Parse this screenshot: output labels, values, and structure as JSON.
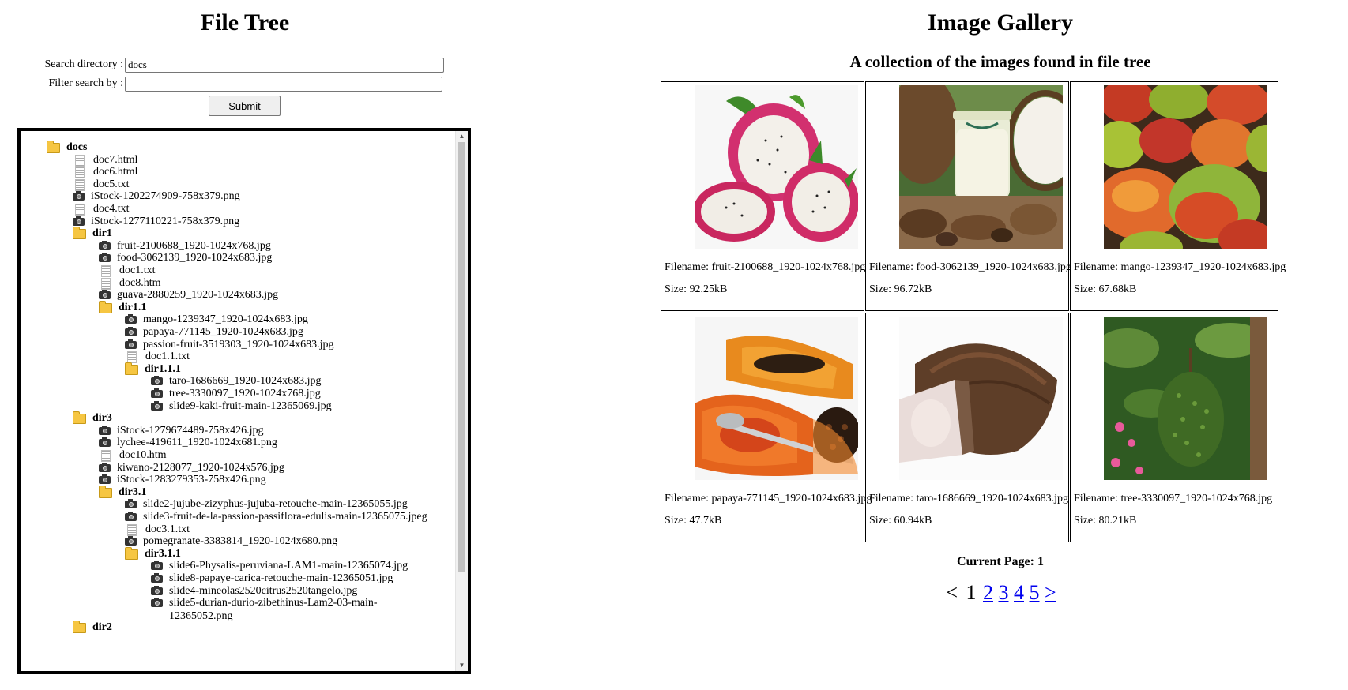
{
  "file_tree": {
    "title": "File Tree",
    "search_label": "Search directory :",
    "search_value": "docs",
    "filter_label": "Filter search by :",
    "filter_value": "",
    "submit_label": "Submit",
    "items": [
      {
        "name": "docs",
        "type": "folder",
        "depth": 0
      },
      {
        "name": "doc7.html",
        "type": "doc",
        "depth": 1
      },
      {
        "name": "doc6.html",
        "type": "doc",
        "depth": 1
      },
      {
        "name": "doc5.txt",
        "type": "doc",
        "depth": 1
      },
      {
        "name": "iStock-1202274909-758x379.png",
        "type": "image",
        "depth": 1
      },
      {
        "name": "doc4.txt",
        "type": "doc",
        "depth": 1
      },
      {
        "name": "iStock-1277110221-758x379.png",
        "type": "image",
        "depth": 1
      },
      {
        "name": "dir1",
        "type": "folder",
        "depth": 1
      },
      {
        "name": "fruit-2100688_1920-1024x768.jpg",
        "type": "image",
        "depth": 2
      },
      {
        "name": "food-3062139_1920-1024x683.jpg",
        "type": "image",
        "depth": 2
      },
      {
        "name": "doc1.txt",
        "type": "doc",
        "depth": 2
      },
      {
        "name": "doc8.htm",
        "type": "doc",
        "depth": 2
      },
      {
        "name": "guava-2880259_1920-1024x683.jpg",
        "type": "image",
        "depth": 2
      },
      {
        "name": "dir1.1",
        "type": "folder",
        "depth": 2
      },
      {
        "name": "mango-1239347_1920-1024x683.jpg",
        "type": "image",
        "depth": 3
      },
      {
        "name": "papaya-771145_1920-1024x683.jpg",
        "type": "image",
        "depth": 3
      },
      {
        "name": "passion-fruit-3519303_1920-1024x683.jpg",
        "type": "image",
        "depth": 3
      },
      {
        "name": "doc1.1.txt",
        "type": "doc",
        "depth": 3
      },
      {
        "name": "dir1.1.1",
        "type": "folder",
        "depth": 3
      },
      {
        "name": "taro-1686669_1920-1024x683.jpg",
        "type": "image",
        "depth": 4
      },
      {
        "name": "tree-3330097_1920-1024x768.jpg",
        "type": "image",
        "depth": 4
      },
      {
        "name": "slide9-kaki-fruit-main-12365069.jpg",
        "type": "image",
        "depth": 4
      },
      {
        "name": "dir3",
        "type": "folder",
        "depth": 1
      },
      {
        "name": "iStock-1279674489-758x426.jpg",
        "type": "image",
        "depth": 2
      },
      {
        "name": "lychee-419611_1920-1024x681.png",
        "type": "image",
        "depth": 2
      },
      {
        "name": "doc10.htm",
        "type": "doc",
        "depth": 2
      },
      {
        "name": "kiwano-2128077_1920-1024x576.jpg",
        "type": "image",
        "depth": 2
      },
      {
        "name": "iStock-1283279353-758x426.png",
        "type": "image",
        "depth": 2
      },
      {
        "name": "dir3.1",
        "type": "folder",
        "depth": 2
      },
      {
        "name": "slide2-jujube-zizyphus-jujuba-retouche-main-12365055.jpg",
        "type": "image",
        "depth": 3
      },
      {
        "name": "slide3-fruit-de-la-passion-passiflora-edulis-main-12365075.jpeg",
        "type": "image",
        "depth": 3
      },
      {
        "name": "doc3.1.txt",
        "type": "doc",
        "depth": 3
      },
      {
        "name": "pomegranate-3383814_1920-1024x680.png",
        "type": "image",
        "depth": 3
      },
      {
        "name": "dir3.1.1",
        "type": "folder",
        "depth": 3
      },
      {
        "name": "slide6-Physalis-peruviana-LAM1-main-12365074.jpg",
        "type": "image",
        "depth": 4
      },
      {
        "name": "slide8-papaye-carica-retouche-main-12365051.jpg",
        "type": "image",
        "depth": 4
      },
      {
        "name": "slide4-mineolas2520citrus2520tangelo.jpg",
        "type": "image",
        "depth": 4
      },
      {
        "name": "slide5-durian-durio-zibethinus-Lam2-03-main-12365052.png",
        "type": "image",
        "depth": 4,
        "wrap": true
      },
      {
        "name": "dir2",
        "type": "folder",
        "depth": 1
      }
    ]
  },
  "gallery": {
    "title": "Image Gallery",
    "subtitle": "A collection of the images found in file tree",
    "filename_prefix": "Filename:",
    "size_prefix": "Size:",
    "images": [
      {
        "filename": "fruit-2100688_1920-1024x768.jpg",
        "size": "92.25kB",
        "subject": "dragon-fruit"
      },
      {
        "filename": "food-3062139_1920-1024x683.jpg",
        "size": "96.72kB",
        "subject": "coconut"
      },
      {
        "filename": "mango-1239347_1920-1024x683.jpg",
        "size": "67.68kB",
        "subject": "mango"
      },
      {
        "filename": "papaya-771145_1920-1024x683.jpg",
        "size": "47.7kB",
        "subject": "papaya"
      },
      {
        "filename": "taro-1686669_1920-1024x683.jpg",
        "size": "60.94kB",
        "subject": "taro"
      },
      {
        "filename": "tree-3330097_1920-1024x768.jpg",
        "size": "80.21kB",
        "subject": "soursop"
      }
    ],
    "current_page_label": "Current Page: 1",
    "pager": {
      "prev": "<",
      "current": "1",
      "pages": [
        "2",
        "3",
        "4",
        "5"
      ],
      "next": ">"
    }
  }
}
